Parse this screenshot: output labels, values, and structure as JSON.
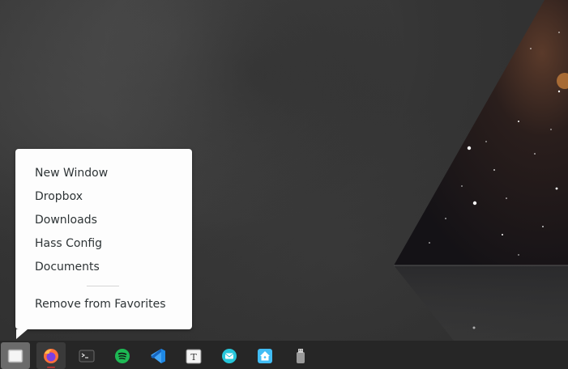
{
  "popup_menu": {
    "items": [
      {
        "label": "New Window"
      },
      {
        "label": "Dropbox"
      },
      {
        "label": "Downloads"
      },
      {
        "label": "Hass Config"
      },
      {
        "label": "Documents"
      }
    ],
    "remove_label": "Remove from Favorites"
  },
  "dock": {
    "apps": [
      {
        "icon": "files-icon",
        "state": "popup-open"
      },
      {
        "icon": "firefox-icon",
        "state": "running"
      },
      {
        "icon": "terminal-icon",
        "state": "idle"
      },
      {
        "icon": "spotify-icon",
        "state": "idle"
      },
      {
        "icon": "vscode-icon",
        "state": "idle"
      },
      {
        "icon": "typora-icon",
        "state": "idle"
      },
      {
        "icon": "mail-icon",
        "state": "idle"
      },
      {
        "icon": "home-assistant-icon",
        "state": "idle"
      },
      {
        "icon": "usb-drive-icon",
        "state": "idle"
      }
    ]
  },
  "colors": {
    "menu_bg": "#fdfdfd",
    "dock_bg": "#262626",
    "spotify": "#1db954",
    "vscode": "#1e88e5",
    "home_assistant": "#41bdf5"
  }
}
